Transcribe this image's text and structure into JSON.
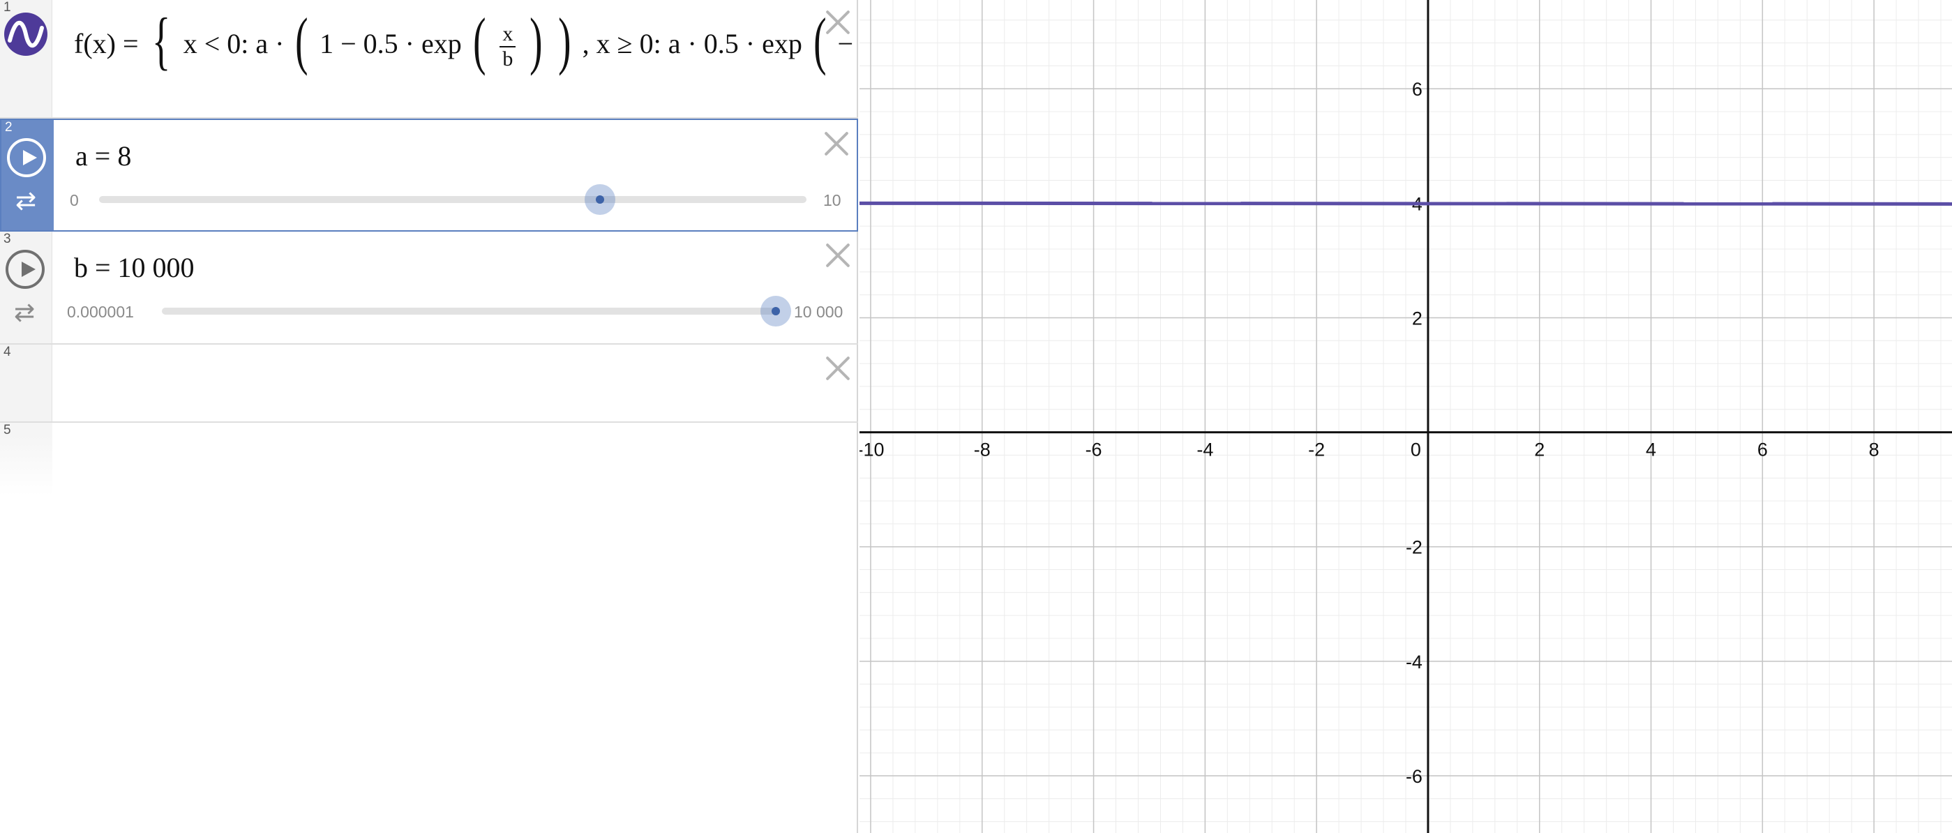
{
  "expressions": [
    {
      "index": "1",
      "latex_parts": {
        "lhs": "f(x) =",
        "c1": "x < 0: a ·",
        "c1b": "1 − 0.5 · exp",
        "frac_num": "x",
        "frac_den": "b",
        "c2": ", x ≥ 0: a  ·  0.5 · exp",
        "tail": "−"
      }
    },
    {
      "index": "2",
      "label": "a = 8",
      "slider": {
        "min": "0",
        "max": "10",
        "value": 8,
        "fraction": 0.8
      }
    },
    {
      "index": "3",
      "label": "b = 10 000",
      "slider": {
        "min": "0.000001",
        "max": "10 000",
        "value": 10000,
        "fraction": 1.0
      }
    },
    {
      "index": "4"
    },
    {
      "index": "5"
    }
  ],
  "graph": {
    "x_ticks": [
      "-10",
      "-8",
      "-6",
      "-4",
      "-2",
      "0",
      "2",
      "4",
      "6",
      "8"
    ],
    "y_ticks": [
      "6",
      "4",
      "2",
      "-2",
      "-4",
      "-6"
    ],
    "x_range": [
      -10.2,
      9.4
    ],
    "y_range": [
      -7.0,
      7.55
    ],
    "curve_color": "#5b4ea6",
    "curve_value_y": 4
  },
  "colors": {
    "accent": "#6a8bc6",
    "logo": "#4e3a99"
  },
  "icons": [
    "desmos-logo-icon",
    "play-icon",
    "loop-icon",
    "close-icon"
  ]
}
